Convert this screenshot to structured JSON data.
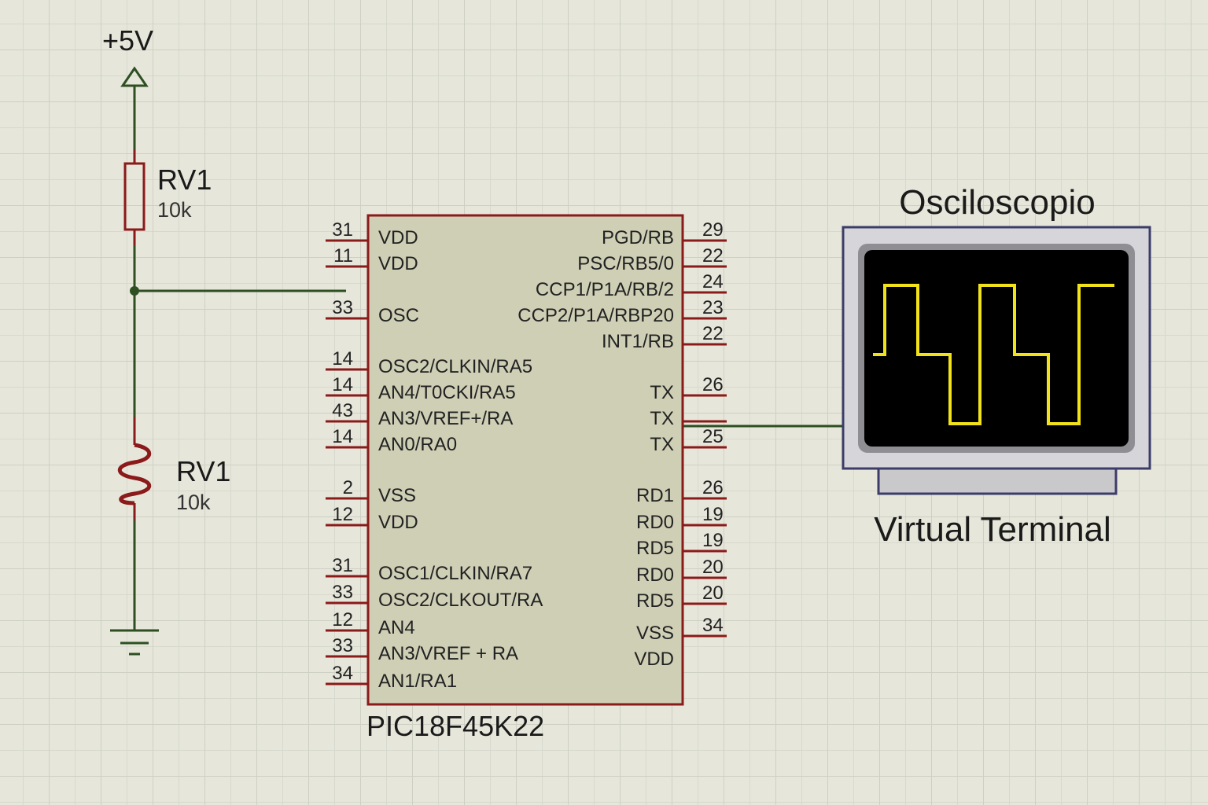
{
  "power": {
    "label": "+5V"
  },
  "resistor": {
    "ref": "RV1",
    "value": "10k"
  },
  "potentiometer": {
    "ref": "RV1",
    "value": "10k"
  },
  "mcu": {
    "part": "PIC18F45K22",
    "left_pins": [
      {
        "num": "31",
        "name": "VDD"
      },
      {
        "num": "11",
        "name": "VDD"
      },
      {
        "num": "33",
        "name": "OSC"
      },
      {
        "num": "14",
        "name": "OSC2/CLKIN/RA5"
      },
      {
        "num": "14",
        "name": "AN4/T0CKI/RA5"
      },
      {
        "num": "43",
        "name": "AN3/VREF+/RA"
      },
      {
        "num": "14",
        "name": "AN0/RA0"
      },
      {
        "num": "2",
        "name": "VSS"
      },
      {
        "num": "12",
        "name": "VDD"
      },
      {
        "num": "31",
        "name": "OSC1/CLKIN/RA7"
      },
      {
        "num": "33",
        "name": "OSC2/CLKOUT/RA"
      },
      {
        "num": "12",
        "name": "AN4"
      },
      {
        "num": "33",
        "name": "AN3/VREF + RA"
      },
      {
        "num": "34",
        "name": "AN1/RA1"
      }
    ],
    "right_pins": [
      {
        "num": "29",
        "name": "PGD/RB"
      },
      {
        "num": "22",
        "name": "PSC/RB5/0"
      },
      {
        "num": "24",
        "name": "CCP1/P1A/RB/2"
      },
      {
        "num": "23",
        "name": "CCP2/P1A/RBP20"
      },
      {
        "num": "22",
        "name": "INT1/RB"
      },
      {
        "num": "26",
        "name": "TX"
      },
      {
        "num": "",
        "name": "TX"
      },
      {
        "num": "25",
        "name": "TX"
      },
      {
        "num": "26",
        "name": "RD1"
      },
      {
        "num": "19",
        "name": "RD0"
      },
      {
        "num": "19",
        "name": "RD5"
      },
      {
        "num": "20",
        "name": "RD0"
      },
      {
        "num": "20",
        "name": "RD5"
      },
      {
        "num": "34",
        "name": "VSS"
      },
      {
        "num": "",
        "name": "VDD"
      }
    ]
  },
  "oscilloscope": {
    "title": "Osciloscopio",
    "caption": "Virtual Terminal",
    "trace_color": "#f2e21a"
  },
  "colors": {
    "wire": "#2d4f22",
    "component": "#8b1a1a",
    "chip_fill": "#cfcfb6"
  }
}
